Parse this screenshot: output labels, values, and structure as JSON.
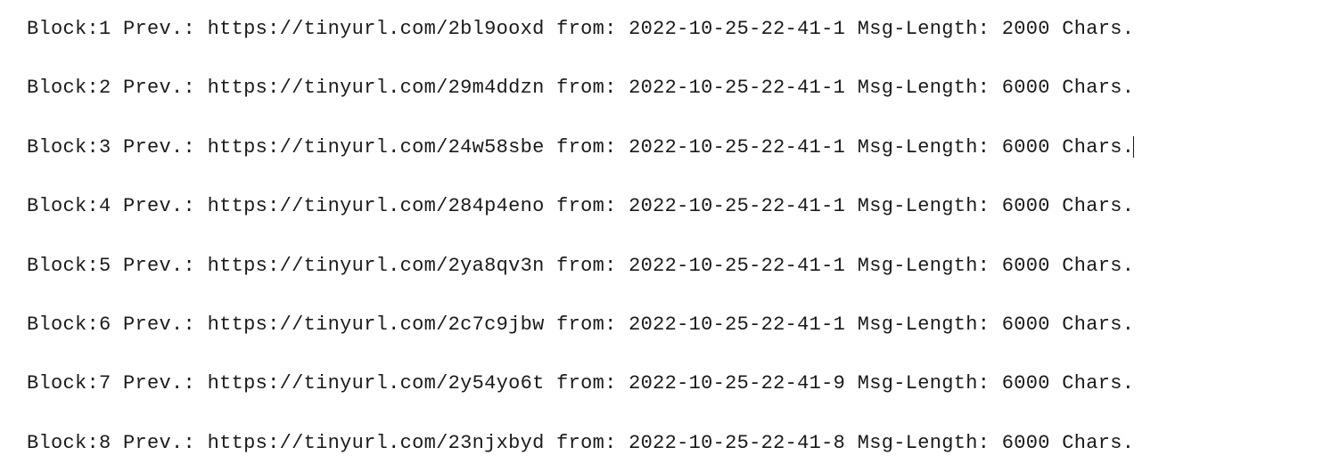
{
  "labels": {
    "block_prefix": "Block:",
    "prev_prefix": " Prev.: ",
    "from_prefix": " from: ",
    "msglen_prefix": " Msg-Length: ",
    "chars_suffix": " Chars."
  },
  "rows": [
    {
      "block": "1",
      "prev": "https://tinyurl.com/2bl9ooxd",
      "from": "2022-10-25-22-41-1",
      "msglen": "2000",
      "cursor": false
    },
    {
      "block": "2",
      "prev": "https://tinyurl.com/29m4ddzn",
      "from": "2022-10-25-22-41-1",
      "msglen": "6000",
      "cursor": false
    },
    {
      "block": "3",
      "prev": "https://tinyurl.com/24w58sbe",
      "from": "2022-10-25-22-41-1",
      "msglen": "6000",
      "cursor": true
    },
    {
      "block": "4",
      "prev": "https://tinyurl.com/284p4eno",
      "from": "2022-10-25-22-41-1",
      "msglen": "6000",
      "cursor": false
    },
    {
      "block": "5",
      "prev": "https://tinyurl.com/2ya8qv3n",
      "from": "2022-10-25-22-41-1",
      "msglen": "6000",
      "cursor": false
    },
    {
      "block": "6",
      "prev": "https://tinyurl.com/2c7c9jbw",
      "from": "2022-10-25-22-41-1",
      "msglen": "6000",
      "cursor": false
    },
    {
      "block": "7",
      "prev": "https://tinyurl.com/2y54yo6t",
      "from": "2022-10-25-22-41-9",
      "msglen": "6000",
      "cursor": false
    },
    {
      "block": "8",
      "prev": "https://tinyurl.com/23njxbyd",
      "from": "2022-10-25-22-41-8",
      "msglen": "6000",
      "cursor": false
    }
  ]
}
